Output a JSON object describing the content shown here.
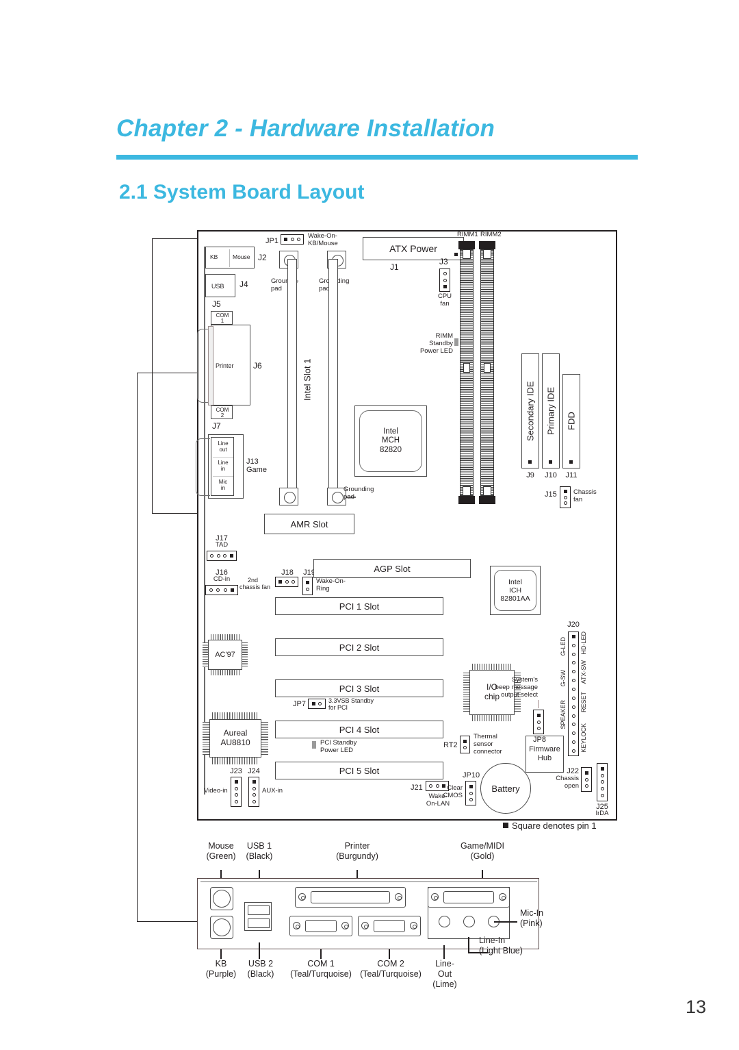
{
  "document": {
    "chapter_title": "Chapter 2 - Hardware Installation",
    "section_title": "2.1  System Board Layout",
    "page_number": "13",
    "accent_color": "#3cb8e0"
  },
  "legend": {
    "pin1_note": "Square denotes pin 1"
  },
  "board": {
    "connectors": {
      "j2_kb": "KB",
      "j2_mouse": "Mouse",
      "j2": "J2",
      "usb": "USB",
      "j4": "J4",
      "j5": "J5",
      "com1": "COM\n1",
      "com1_line1": "COM",
      "com1_line2": "1",
      "printer": "Printer",
      "j6": "J6",
      "com2_line1": "COM",
      "com2_line2": "2",
      "j7": "J7",
      "line_out": "Line\nout",
      "line_out_l1": "Line",
      "line_out_l2": "out",
      "line_in_l1": "Line",
      "line_in_l2": "in",
      "mic_in_l1": "Mic",
      "mic_in_l2": "in",
      "j13_game_l1": "J13",
      "j13_game_l2": "Game"
    },
    "jumpers": {
      "jp1": "JP1",
      "jp1_label_l1": "Wake-On-",
      "jp1_label_l2": "KB/Mouse",
      "jp7": "JP7",
      "jp7_label_l1": "3.3VSB Standby",
      "jp7_label_l2": "for PCI",
      "jp8": "JP8",
      "jp8_label_l1": "System's",
      "jp8_label_l2": "beep message",
      "jp8_label_l3": "output select",
      "jp10": "JP10",
      "jp10_label_l1": "Clear",
      "jp10_label_l2": "CMOS",
      "j18": "J18",
      "j18_label_l1": "2nd",
      "j18_label_l2": "chassis fan",
      "j19": "J19",
      "j19_label_l1": "Wake-On-",
      "j19_label_l2": "Ring",
      "j21": "J21",
      "j21_label_l1": "Wake-",
      "j21_label_l2": "On-LAN",
      "j22": "J22",
      "j22_label_l1": "Chassis",
      "j22_label_l2": "open",
      "j25": "J25",
      "j25_label": "IrDA",
      "j3": "J3",
      "j3_label_l1": "CPU",
      "j3_label_l2": "fan",
      "j15": "J15",
      "j15_label_l1": "Chassis",
      "j15_label_l2": "fan",
      "j16": "J16",
      "j16_label": "CD-in",
      "j17": "J17",
      "j17_label": "TAD",
      "j23": "J23",
      "j23_label": "Video-in",
      "j24": "J24",
      "j24_label": "AUX-in",
      "rt2": "RT2",
      "rt2_label_l1": "Thermal",
      "rt2_label_l2": "sensor",
      "rt2_label_l3": "connector"
    },
    "power": {
      "atx_power": "ATX Power",
      "j1": "J1"
    },
    "memory": {
      "rimm1": "RIMM1",
      "rimm2": "RIMM2",
      "standby_l1": "RIMM",
      "standby_l2": "Standby",
      "standby_l3": "Power LED"
    },
    "drives": {
      "secondary_ide": "Secondary IDE",
      "primary_ide": "Primary IDE",
      "fdd": "FDD",
      "j9": "J9",
      "j10": "J10",
      "j11": "J11"
    },
    "slots": {
      "cpu_slot": "Intel Slot 1",
      "amr": "AMR Slot",
      "agp": "AGP Slot",
      "pci1": "PCI 1 Slot",
      "pci2": "PCI 2 Slot",
      "pci3": "PCI 3 Slot",
      "pci4": "PCI 4 Slot",
      "pci5": "PCI 5 Slot"
    },
    "chips": {
      "mch_l1": "Intel",
      "mch_l2": "MCH",
      "mch_l3": "82820",
      "ich_l1": "Intel",
      "ich_l2": "ICH",
      "ich_l3": "82801AA",
      "io_chip_l1": "I/O",
      "io_chip_l2": "chip",
      "ac97": "AC'97",
      "aureal_l1": "Aureal",
      "aureal_l2": "AU8810",
      "firmware_l1": "Firmware",
      "firmware_l2": "Hub",
      "battery": "Battery"
    },
    "misc": {
      "grounding_pad_l1": "Grounding",
      "grounding_pad_l2": "pad",
      "pci_standby_l1": "PCI Standby",
      "pci_standby_l2": "Power LED"
    },
    "j20_header": {
      "name": "J20",
      "signals": [
        "G-LED",
        "HD-LED",
        "G-SW",
        "ATX-SW",
        "RESET",
        "SPEAKER",
        "KEYLOCK"
      ]
    }
  },
  "rear_panel": {
    "top_labels": [
      {
        "name": "Mouse",
        "color": "(Green)"
      },
      {
        "name": "USB 1",
        "color": "(Black)"
      },
      {
        "name": "Printer",
        "color": "(Burgundy)"
      },
      {
        "name": "Game/MIDI",
        "color": "(Gold)"
      }
    ],
    "bottom_labels": [
      {
        "name": "KB",
        "color": "(Purple)"
      },
      {
        "name": "USB 2",
        "color": "(Black)"
      },
      {
        "name": "COM 1",
        "color": "(Teal/Turquoise)"
      },
      {
        "name": "COM 2",
        "color": "(Teal/Turquoise)"
      },
      {
        "name": "Line-\nOut",
        "color": "(Lime)"
      },
      {
        "name": "Line-In",
        "color": "(Light Blue)"
      }
    ],
    "line_out_l1": "Line-",
    "line_out_l2": "Out",
    "line_out_color": "(Lime)",
    "line_in": "Line-In",
    "line_in_color": "(Light Blue)",
    "mic_in": "Mic-In",
    "mic_in_color": "(Pink)"
  }
}
